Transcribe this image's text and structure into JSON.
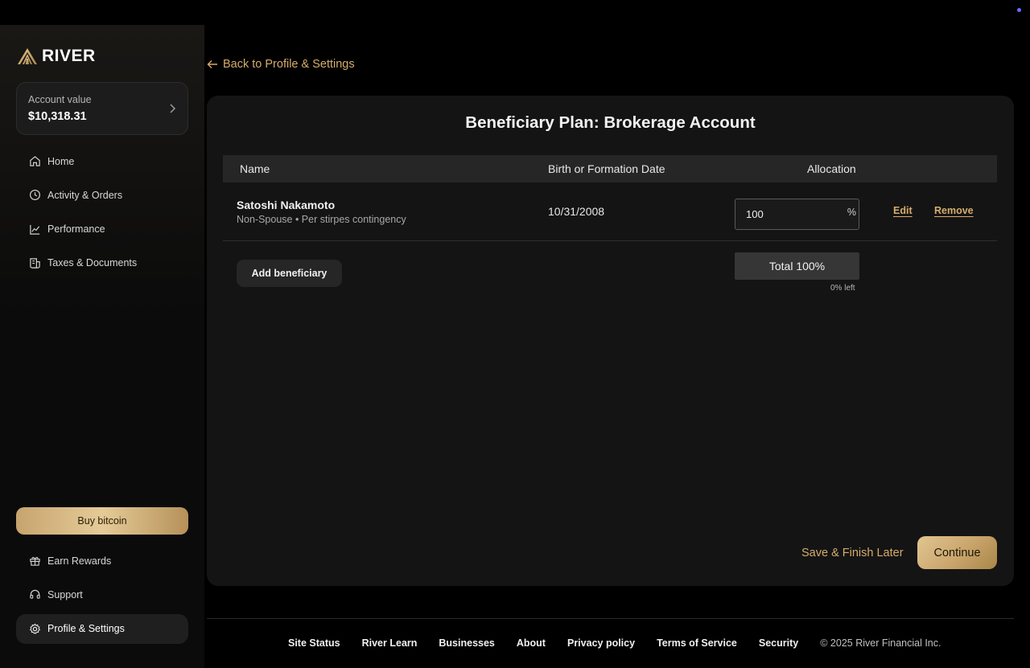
{
  "brand": {
    "name": "RIVER"
  },
  "sidebar": {
    "account": {
      "label": "Account value",
      "value": "$10,318.31"
    },
    "nav": [
      {
        "label": "Home",
        "icon": "home-icon"
      },
      {
        "label": "Activity & Orders",
        "icon": "clock-icon"
      },
      {
        "label": "Performance",
        "icon": "chart-icon"
      },
      {
        "label": "Taxes & Documents",
        "icon": "document-icon"
      }
    ],
    "buy_label": "Buy bitcoin",
    "bottom_nav": [
      {
        "label": "Earn Rewards",
        "icon": "gift-icon"
      },
      {
        "label": "Support",
        "icon": "headset-icon"
      },
      {
        "label": "Profile & Settings",
        "icon": "gear-icon",
        "active": true
      }
    ]
  },
  "main": {
    "back_label": "Back to Profile & Settings",
    "title": "Beneficiary Plan: Brokerage Account",
    "columns": {
      "name": "Name",
      "date": "Birth or Formation Date",
      "allocation": "Allocation"
    },
    "beneficiaries": [
      {
        "name": "Satoshi Nakamoto",
        "details": "Non-Spouse • Per stirpes contingency",
        "date": "10/31/2008",
        "allocation": "100",
        "edit_label": "Edit",
        "remove_label": "Remove"
      }
    ],
    "percent_sign": "%",
    "add_label": "Add beneficiary",
    "total_label": "Total 100%",
    "remaining_label": "0% left",
    "save_later_label": "Save & Finish Later",
    "continue_label": "Continue"
  },
  "footer": {
    "links": [
      "Site Status",
      "River Learn",
      "Businesses",
      "About",
      "Privacy policy",
      "Terms of Service",
      "Security"
    ],
    "copyright": "© 2025 River Financial Inc."
  },
  "colors": {
    "accent": "#d6ac6c",
    "gold_button": "#c9a56c",
    "panel": "#141414",
    "background": "#000000"
  }
}
